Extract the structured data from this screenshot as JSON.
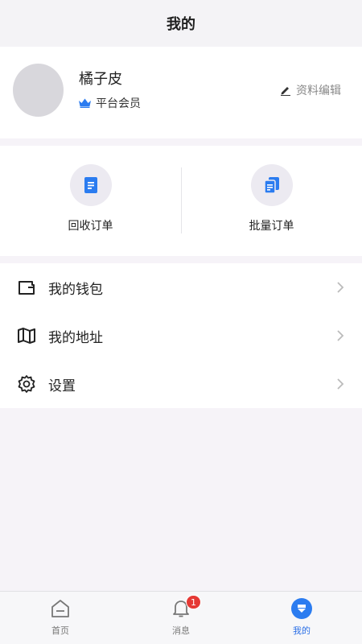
{
  "header": {
    "title": "我的"
  },
  "profile": {
    "name": "橘子皮",
    "member_label": "平台会员",
    "edit_label": "资料编辑"
  },
  "orders": [
    {
      "label": "回收订单",
      "icon": "document-icon"
    },
    {
      "label": "批量订单",
      "icon": "stacked-documents-icon"
    }
  ],
  "menu": [
    {
      "label": "我的钱包",
      "icon": "wallet-icon"
    },
    {
      "label": "我的地址",
      "icon": "map-icon"
    },
    {
      "label": "设置",
      "icon": "gear-icon"
    }
  ],
  "tabbar": {
    "tabs": [
      {
        "label": "首页",
        "icon": "home-icon"
      },
      {
        "label": "消息",
        "icon": "bell-icon",
        "badge": "1"
      },
      {
        "label": "我的",
        "icon": "profile-icon",
        "active": true
      }
    ]
  },
  "colors": {
    "accent": "#2b7cf0",
    "badge": "#e53935",
    "background": "#f6f3f8"
  }
}
